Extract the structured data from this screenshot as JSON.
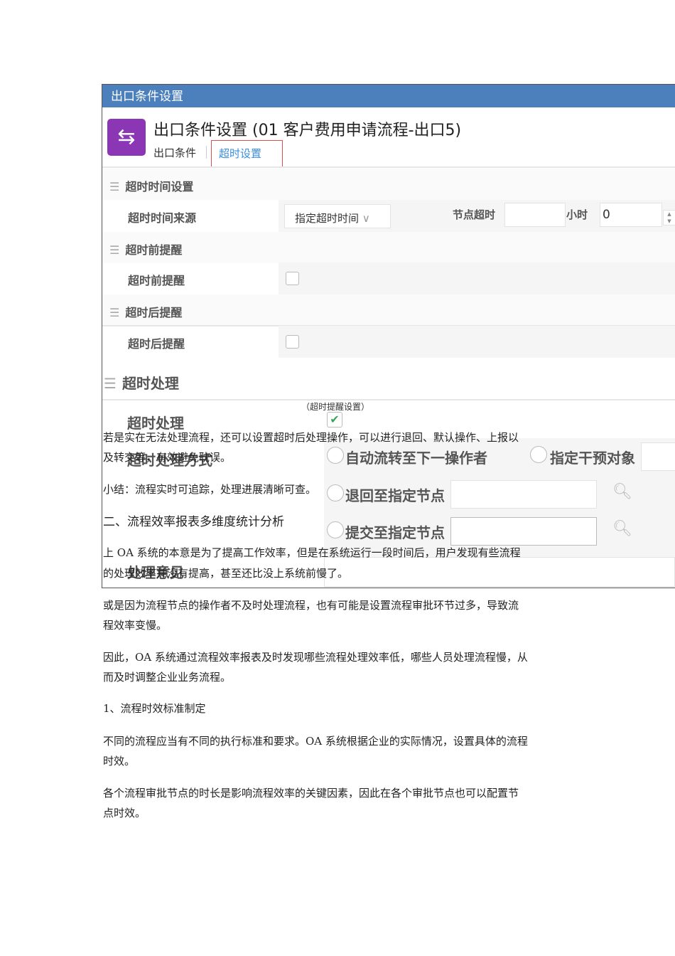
{
  "screenshot": {
    "window_title": "出口条件设置",
    "page_title": "出口条件设置 (01 客户费用申请流程-出口5)",
    "tabs": [
      "出口条件",
      "超时设置"
    ],
    "sections": {
      "timeout_time": "超时时间设置",
      "before_remind": "超时前提醒",
      "after_remind": "超时后提醒",
      "handling": "超时处理"
    },
    "fields": {
      "time_source_label": "超时时间来源",
      "time_source_value": "指定超时时间",
      "node_timeout_label": "节点超时",
      "hours_label": "小时",
      "hours_value": "0",
      "before_remind_label": "超时前提醒",
      "after_remind_label": "超时后提醒",
      "handling_label": "超时处理",
      "handling_mode_label": "超时处理方式",
      "opinion_label": "处理意见"
    },
    "options": [
      "自动流转至下一操作者",
      "指定干预对象",
      "退回至指定节点",
      "提交至指定节点"
    ]
  },
  "caption": "（超时提醒设置）",
  "paragraphs": [
    "若是实在无法处理流程，还可以设置超时后处理操作，可以进行退回、默认操作、上报以",
    "及转交等，有效避免耽误。",
    "小结：流程实时可追踪，处理进展清晰可查。",
    "二、流程效率报表多维度统计分析",
    "上 OA 系统的本意是为了提高工作效率，但是在系统运行一段时间后，用户发现有些流程",
    "的处理效率并没有提高，甚至还比没上系统前慢了。",
    "或是因为流程节点的操作者不及时处理流程，也有可能是设置流程审批环节过多，导致流",
    "程效率变慢。",
    "因此，OA 系统通过流程效率报表及时发现哪些流程处理效率低，哪些人员处理流程慢，从",
    "而及时调整企业业务流程。",
    "1、流程时效标准制定",
    "不同的流程应当有不同的执行标准和要求。OA 系统根据企业的实际情况，设置具体的流程",
    "时效。",
    "各个流程审批节点的时长是影响流程效率的关键因素，因此在各个审批节点也可以配置节",
    "点时效。"
  ]
}
